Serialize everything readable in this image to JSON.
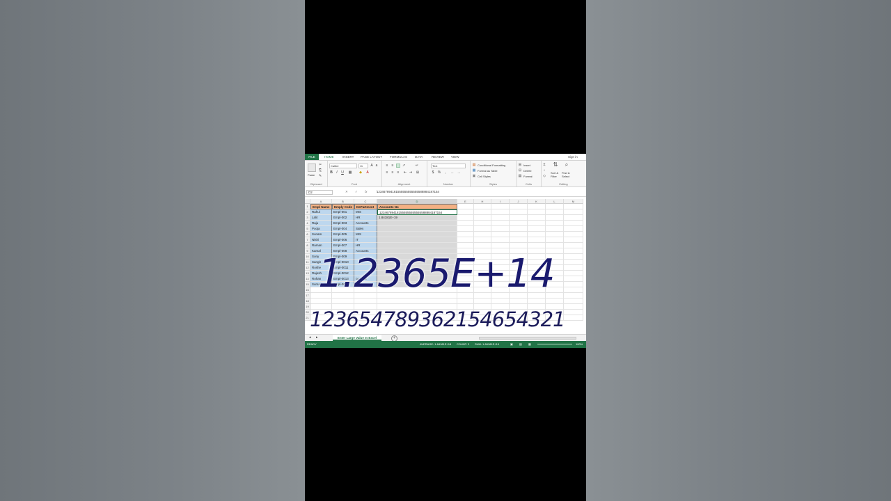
{
  "ribbon": {
    "file": "FILE",
    "tabs": [
      "HOME",
      "INSERT",
      "PAGE LAYOUT",
      "FORMULAS",
      "DATA",
      "REVIEW",
      "VIEW"
    ],
    "sign_in": "Sign in",
    "clipboard": {
      "paste": "Paste",
      "label": "Clipboard"
    },
    "font": {
      "name": "Calibri",
      "size": "11",
      "label": "Font"
    },
    "alignment": {
      "label": "Alignment"
    },
    "number": {
      "format": "Text",
      "label": "Number"
    },
    "styles": {
      "cond_format": "Conditional Formatting",
      "format_table": "Format as Table",
      "cell_styles": "Cell Styles",
      "label": "Styles"
    },
    "cells": {
      "insert": "Insert",
      "delete": "Delete",
      "format": "Format",
      "label": "Cells"
    },
    "editing": {
      "sort": "Sort & Filter",
      "find": "Find & Select",
      "label": "Editing"
    }
  },
  "formula_bar": {
    "name_box": "D2",
    "content": "'123467894181555555555555588884187154"
  },
  "columns": [
    "A",
    "B",
    "C",
    "D",
    "E",
    "H",
    "I",
    "J",
    "K",
    "L",
    "M"
  ],
  "table": {
    "headers": [
      "Empl Name",
      "Emply Code",
      "DePartment",
      "Accounts No"
    ],
    "rows": [
      [
        "Rahul",
        "Empl-001",
        "MIS",
        "123467894181555555555555588884187154"
      ],
      [
        "Lalit",
        "Empl-002",
        "HR",
        "1.84181E+19"
      ],
      [
        "Raju",
        "Empl-003",
        "Accounts",
        ""
      ],
      [
        "Pooja",
        "Empl-004",
        "Sales",
        ""
      ],
      [
        "Sonam",
        "Empl-005",
        "MIS",
        ""
      ],
      [
        "Nishi",
        "Empl-006",
        "IT",
        ""
      ],
      [
        "Raman",
        "Empl-007",
        "HR",
        ""
      ],
      [
        "Kamal",
        "Empl-008",
        "Accounts",
        ""
      ],
      [
        "Sony",
        "Empl-009",
        "",
        ""
      ],
      [
        "Sangit",
        "Empl-0010",
        "",
        ""
      ],
      [
        "Roshe",
        "Empl-0011",
        "",
        ""
      ],
      [
        "Rajesh",
        "Empl-0012",
        "",
        ""
      ],
      [
        "Rohan",
        "Empl-0013",
        "ccounts",
        ""
      ],
      [
        "Suma",
        "Empl-0014",
        "",
        ""
      ]
    ],
    "row_numbers": [
      "1",
      "2",
      "3",
      "4",
      "5",
      "6",
      "7",
      "8",
      "9",
      "10",
      "11",
      "12",
      "13",
      "14",
      "15",
      "16",
      "17",
      "18",
      "19",
      "20",
      "21"
    ]
  },
  "overlays": {
    "scientific": "1.2365E+14",
    "long_number": "123654789362154654321"
  },
  "sheet": {
    "tab_name": "Enter Large Value In Excel",
    "add": "+"
  },
  "status": {
    "ready": "READY",
    "average": "AVERAGE: 1.84181E+18",
    "count": "COUNT: 2",
    "sum": "SUM: 1.84181E+19",
    "zoom": "100%"
  },
  "colors": {
    "excel_green": "#217346",
    "header_fill": "#f4b183",
    "code_fill": "#bdd7ee",
    "overlay_ink": "#1a1a6e"
  }
}
